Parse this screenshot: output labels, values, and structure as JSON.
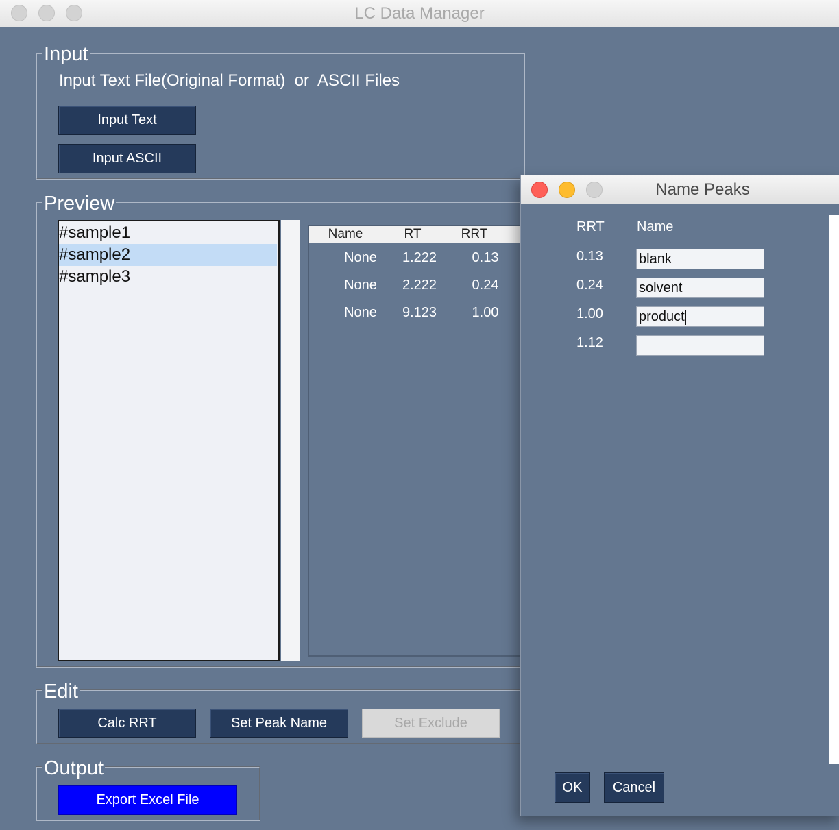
{
  "window": {
    "title": "LC Data Manager"
  },
  "input_group": {
    "title": "Input",
    "caption": "Input Text File(Original Format)  or  ASCII Files",
    "input_text_button": "Input Text",
    "input_ascii_button": "Input ASCII"
  },
  "preview_group": {
    "title": "Preview",
    "samples": [
      {
        "label": "#sample1",
        "selected": false
      },
      {
        "label": "#sample2",
        "selected": true
      },
      {
        "label": "#sample3",
        "selected": false
      }
    ],
    "table": {
      "columns": [
        "Name",
        "RT",
        "RRT"
      ],
      "rows": [
        [
          "None",
          "1.222",
          "0.13"
        ],
        [
          "None",
          "2.222",
          "0.24"
        ],
        [
          "None",
          "9.123",
          "1.00"
        ]
      ]
    }
  },
  "edit_group": {
    "title": "Edit",
    "calc_rrt_button": "Calc RRT",
    "set_peak_name_button": "Set Peak Name",
    "set_exclude_button": "Set Exclude"
  },
  "output_group": {
    "title": "Output",
    "export_button": "Export Excel File"
  },
  "dialog": {
    "title": "Name Peaks",
    "rrt_header": "RRT",
    "name_header": "Name",
    "rows": [
      {
        "rrt": "0.13",
        "name": "blank"
      },
      {
        "rrt": "0.24",
        "name": "solvent"
      },
      {
        "rrt": "1.00",
        "name": "product"
      },
      {
        "rrt": "1.12",
        "name": ""
      }
    ],
    "ok_button": "OK",
    "cancel_button": "Cancel"
  },
  "colors": {
    "background": "#647790",
    "button": "#253a5b",
    "export_button": "#0000ff",
    "selection": "#c3dcf6",
    "traffic_close": "#fe5f57",
    "traffic_minimize": "#febc2e",
    "traffic_zoom_inactive": "#d3d3d3"
  }
}
